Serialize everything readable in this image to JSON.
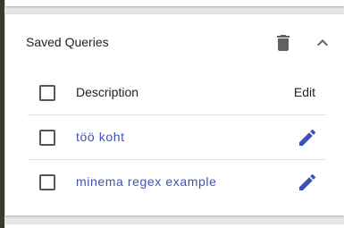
{
  "panel": {
    "title": "Saved Queries",
    "delete_icon": "trash-icon",
    "collapse_icon": "chevron-up-icon"
  },
  "table": {
    "headers": {
      "description": "Description",
      "edit": "Edit"
    },
    "rows": [
      {
        "description": "töö koht",
        "edit_icon": "pencil-icon",
        "checked": false
      },
      {
        "description": "minema regex example",
        "edit_icon": "pencil-icon",
        "checked": false
      }
    ]
  },
  "colors": {
    "accent": "#3f51b5",
    "icon_gray": "#616161",
    "text": "#212121"
  }
}
